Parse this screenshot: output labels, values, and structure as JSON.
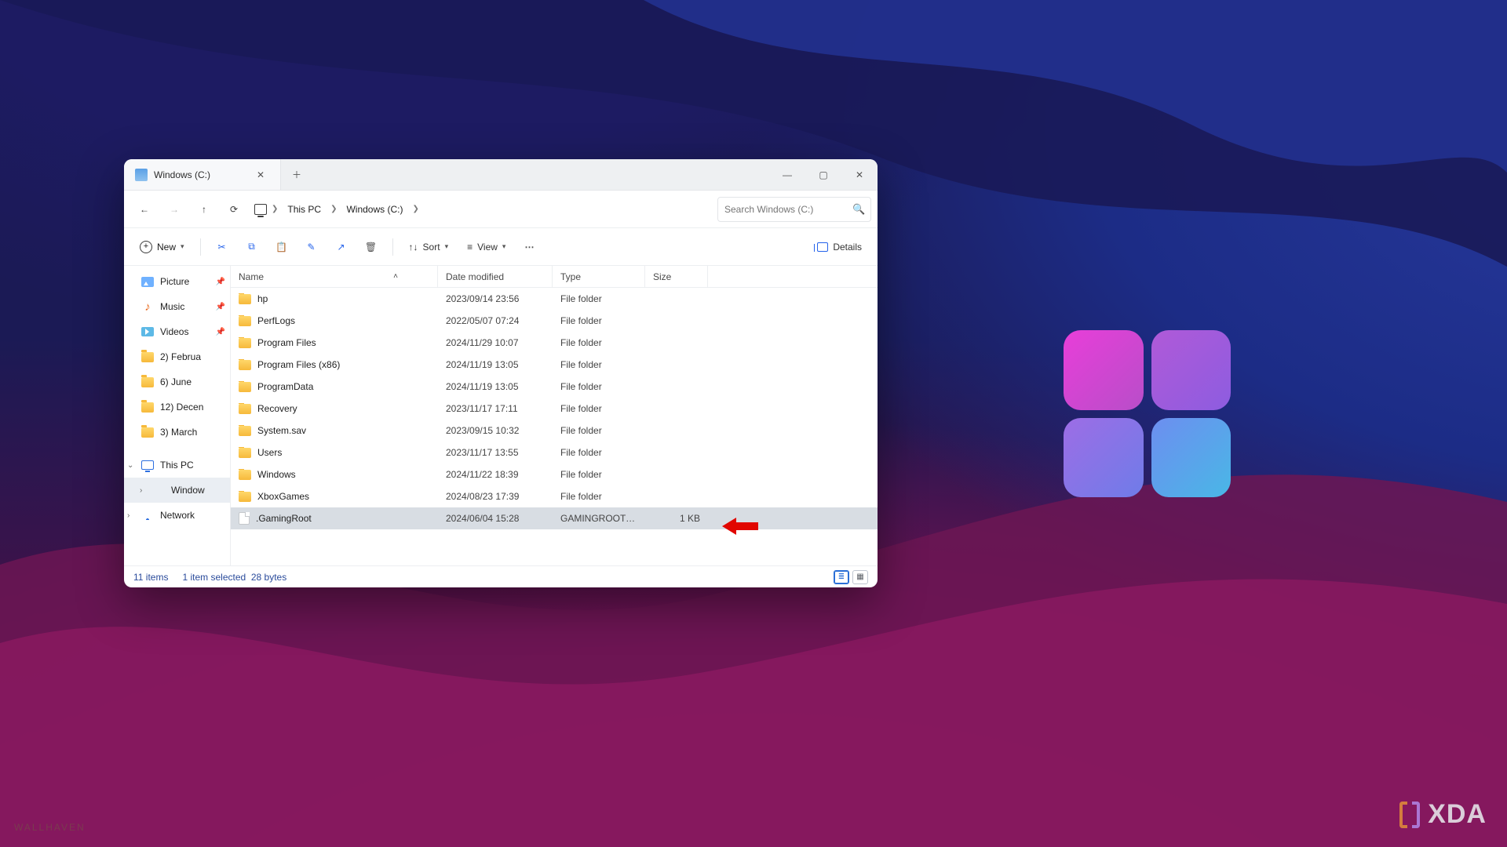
{
  "tab": {
    "title": "Windows (C:)"
  },
  "breadcrumb": {
    "seg1": "This PC",
    "seg2": "Windows (C:)"
  },
  "search": {
    "placeholder": "Search Windows (C:)"
  },
  "toolbar": {
    "new_label": "New",
    "sort_label": "Sort",
    "view_label": "View",
    "details_label": "Details"
  },
  "columns": {
    "name": "Name",
    "date": "Date modified",
    "type": "Type",
    "size": "Size"
  },
  "sidebar": {
    "items": [
      {
        "label": "Picture",
        "icon": "pictures",
        "pinned": true
      },
      {
        "label": "Music",
        "icon": "music",
        "pinned": true
      },
      {
        "label": "Videos",
        "icon": "videos",
        "pinned": true
      },
      {
        "label": "2) Februa",
        "icon": "folder"
      },
      {
        "label": "6) June",
        "icon": "folder"
      },
      {
        "label": "12) Decen",
        "icon": "folder"
      },
      {
        "label": "3) March",
        "icon": "folder"
      }
    ],
    "thispc": "This PC",
    "windows": "Window",
    "network": "Network"
  },
  "files": [
    {
      "name": "hp",
      "date": "2023/09/14 23:56",
      "type": "File folder",
      "size": "",
      "icon": "folder"
    },
    {
      "name": "PerfLogs",
      "date": "2022/05/07 07:24",
      "type": "File folder",
      "size": "",
      "icon": "folder"
    },
    {
      "name": "Program Files",
      "date": "2024/11/29 10:07",
      "type": "File folder",
      "size": "",
      "icon": "folder"
    },
    {
      "name": "Program Files (x86)",
      "date": "2024/11/19 13:05",
      "type": "File folder",
      "size": "",
      "icon": "folder"
    },
    {
      "name": "ProgramData",
      "date": "2024/11/19 13:05",
      "type": "File folder",
      "size": "",
      "icon": "folder"
    },
    {
      "name": "Recovery",
      "date": "2023/11/17 17:11",
      "type": "File folder",
      "size": "",
      "icon": "folder"
    },
    {
      "name": "System.sav",
      "date": "2023/09/15 10:32",
      "type": "File folder",
      "size": "",
      "icon": "folder"
    },
    {
      "name": "Users",
      "date": "2023/11/17 13:55",
      "type": "File folder",
      "size": "",
      "icon": "folder"
    },
    {
      "name": "Windows",
      "date": "2024/11/22 18:39",
      "type": "File folder",
      "size": "",
      "icon": "folder"
    },
    {
      "name": "XboxGames",
      "date": "2024/08/23 17:39",
      "type": "File folder",
      "size": "",
      "icon": "folder"
    },
    {
      "name": ".GamingRoot",
      "date": "2024/06/04 15:28",
      "type": "GAMINGROOT File",
      "size": "1 KB",
      "icon": "file",
      "selected": true
    }
  ],
  "status": {
    "items": "11 items",
    "selection": "1 item selected",
    "bytes": "28 bytes"
  },
  "watermarks": {
    "wallhaven": "WALLHAVEN",
    "xda": "XDA"
  }
}
